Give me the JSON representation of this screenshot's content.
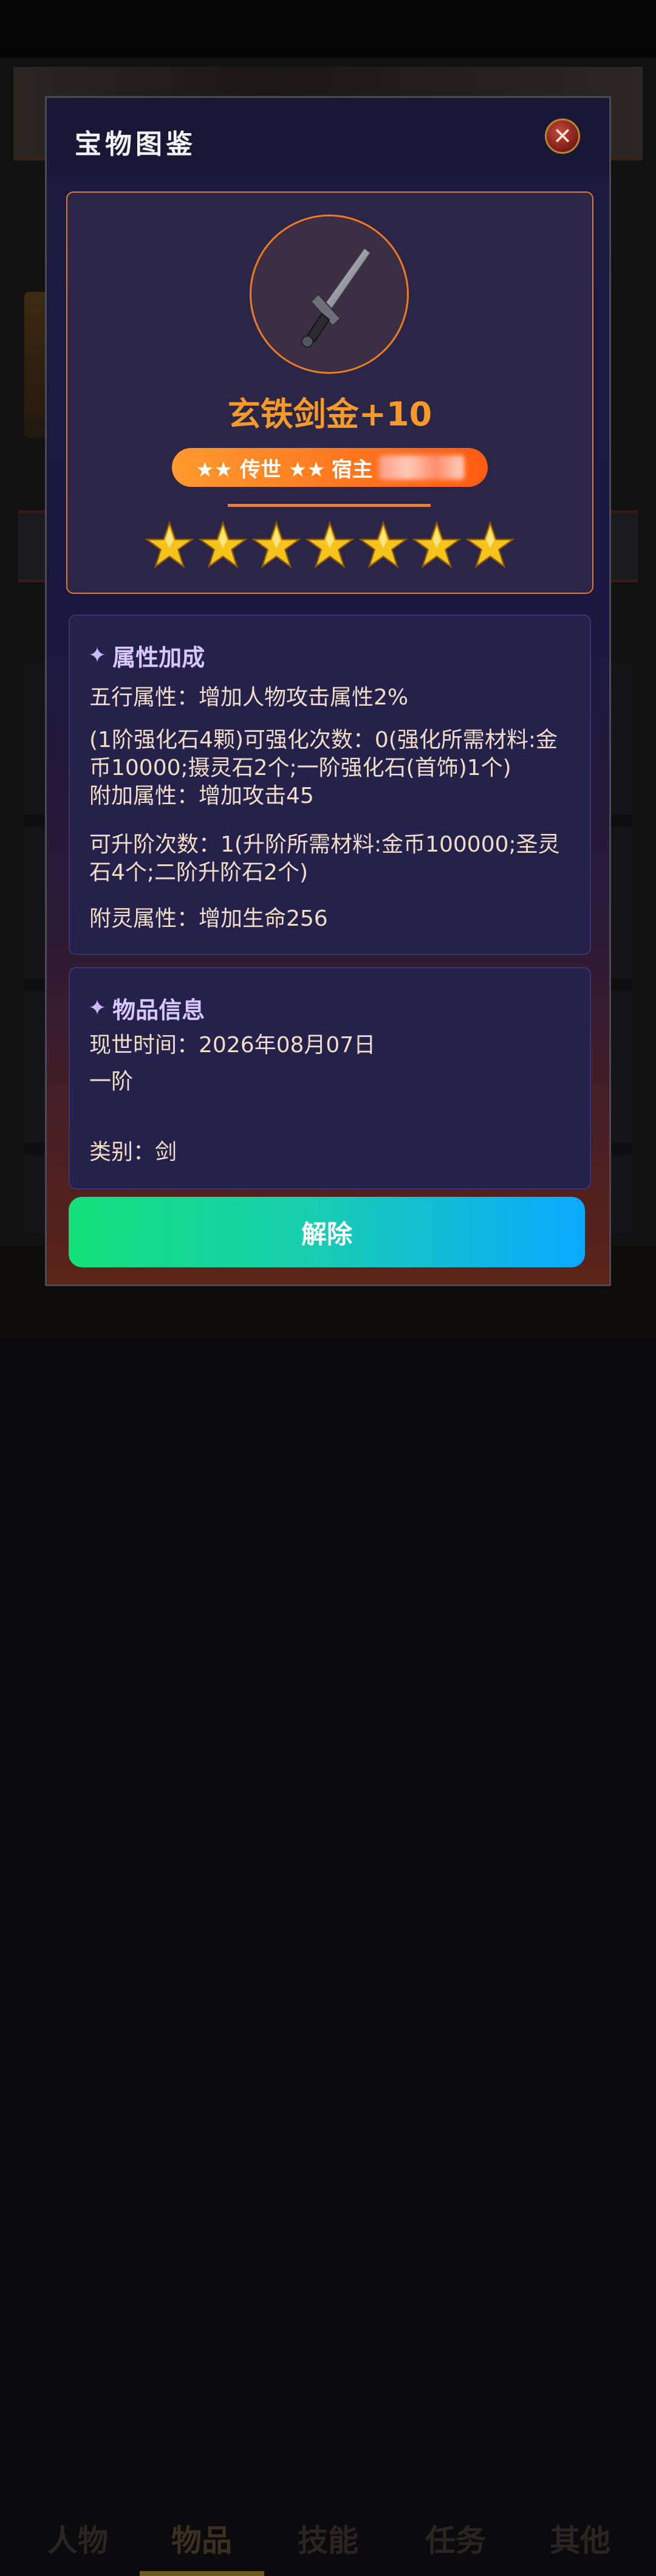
{
  "background": {
    "tabs": [
      "人物",
      "物品",
      "技能",
      "任务",
      "其他"
    ]
  },
  "modal": {
    "title": "宝物图鉴",
    "close_icon": "close-x-icon"
  },
  "item": {
    "icon": "sword-icon",
    "name": "玄铁剑金+10",
    "rank_left": "★★ 传世 ★★",
    "rank_owner_label": "宿主",
    "stars_count": 7
  },
  "attributes": {
    "title": "属性加成",
    "lines": [
      "五行属性：增加人物攻击属性2%",
      "(1阶强化石4颗)可强化次数：0(强化所需材料:金币10000;摄灵石2个;一阶强化石(首饰)1个)",
      "附加属性：增加攻击45",
      "可升阶次数：1(升阶所需材料:金币100000;圣灵石4个;二阶升阶石2个)",
      "附灵属性：增加生命256"
    ]
  },
  "info": {
    "title": "物品信息",
    "time": "现世时间：2026年08月07日",
    "tier": "一阶",
    "category": "类别：剑"
  },
  "actions": {
    "release_label": "解除"
  },
  "colors": {
    "accent_orange": "#f49a2a",
    "button_green": "#13e07a",
    "button_blue": "#0aa9ff"
  }
}
